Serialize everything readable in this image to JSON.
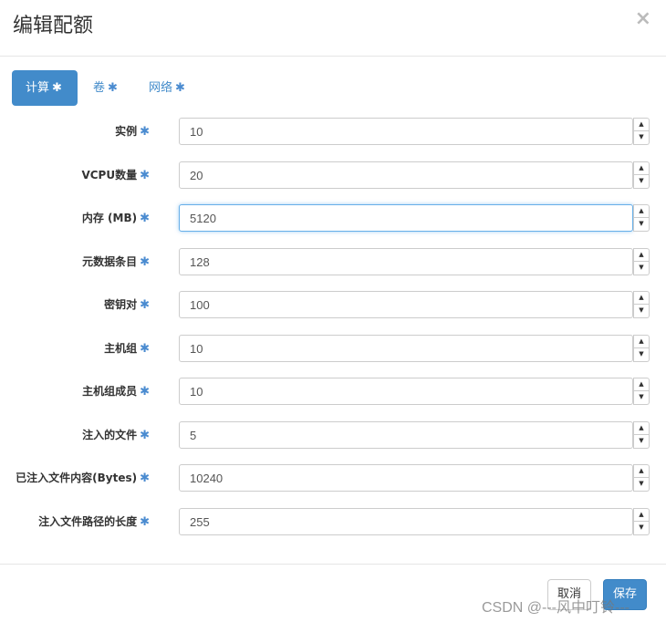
{
  "dialog": {
    "title": "编辑配额",
    "close_symbol": "×"
  },
  "tabs": [
    {
      "label": "计算",
      "required_mark": "✱",
      "active": true
    },
    {
      "label": "卷",
      "required_mark": "✱",
      "active": false
    },
    {
      "label": "网络",
      "required_mark": "✱",
      "active": false
    }
  ],
  "fields": [
    {
      "label": "实例",
      "required_mark": "✱",
      "value": "10"
    },
    {
      "label": "VCPU数量",
      "required_mark": "✱",
      "value": "20"
    },
    {
      "label": "内存 (MB)",
      "required_mark": "✱",
      "value": "5120",
      "focused": true
    },
    {
      "label": "元数据条目",
      "required_mark": "✱",
      "value": "128"
    },
    {
      "label": "密钥对",
      "required_mark": "✱",
      "value": "100"
    },
    {
      "label": "主机组",
      "required_mark": "✱",
      "value": "10"
    },
    {
      "label": "主机组成员",
      "required_mark": "✱",
      "value": "10"
    },
    {
      "label": "注入的文件",
      "required_mark": "✱",
      "value": "5"
    },
    {
      "label": "已注入文件内容(Bytes)",
      "required_mark": "✱",
      "value": "10240"
    },
    {
      "label": "注入文件路径的长度",
      "required_mark": "✱",
      "value": "255"
    }
  ],
  "spinner": {
    "up_icon": "▲",
    "down_icon": "▼"
  },
  "footer": {
    "cancel_label": "取消",
    "save_label": "保存"
  },
  "watermark": "CSDN @---风中叮铃---",
  "colors": {
    "primary": "#428bca",
    "focus_border": "#66afe9",
    "star": "#4a8bd0"
  }
}
